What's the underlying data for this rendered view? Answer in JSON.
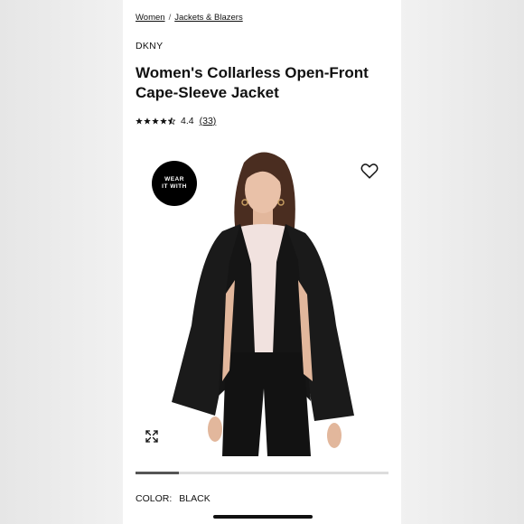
{
  "breadcrumb": {
    "items": [
      "Women",
      "Jackets & Blazers"
    ],
    "separator": "/"
  },
  "product": {
    "brand": "DKNY",
    "title": "Women's Collarless Open-Front Cape-Sleeve Jacket",
    "rating": {
      "value": "4.4",
      "count": "(33)",
      "stars_filled": 4.4,
      "stars_max": 5
    }
  },
  "hero": {
    "badge_label": "WEAR\nIT WITH",
    "favorite_icon": "heart-outline-icon",
    "expand_icon": "expand-arrows-icon"
  },
  "carousel": {
    "progress": 0.17
  },
  "color": {
    "label": "COLOR:",
    "value": "BLACK"
  },
  "colors": {
    "text": "#111111",
    "jacket": "#1a1a1a",
    "blouse": "#f1e2df",
    "skin": "#e6bda4",
    "hair": "#4a2d20",
    "background": "#ececec"
  }
}
